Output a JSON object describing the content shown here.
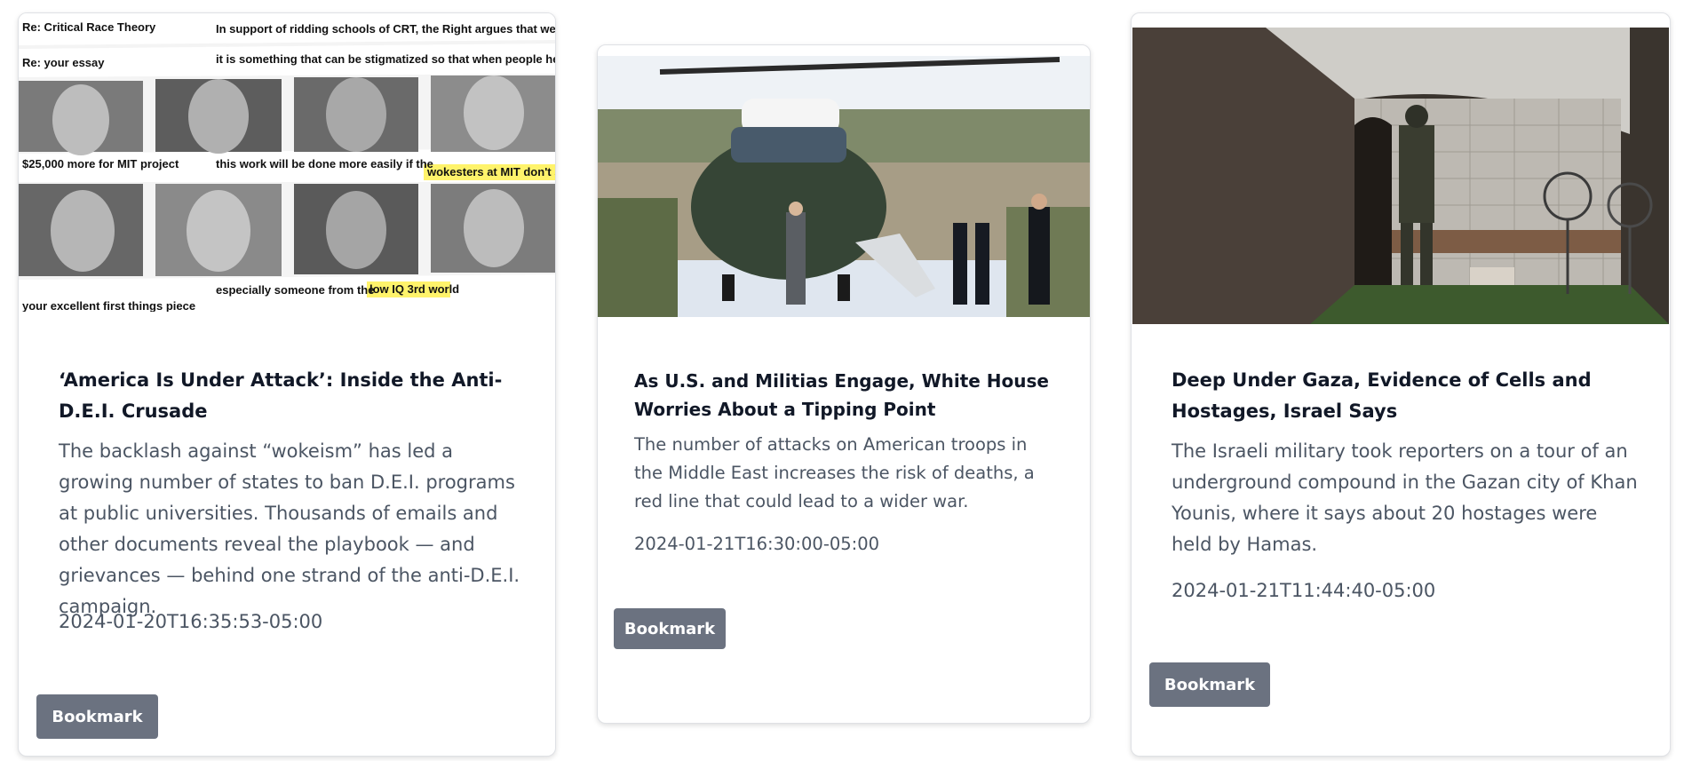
{
  "articles": [
    {
      "title": "‘America Is Under Attack’: Inside the Anti-D.E.I. Crusade",
      "description": "The backlash against “wokeism” has led a growing number of states to ban D.E.I. programs at public universities. Thousands of emails and other documents reveal the playbook — and grievances — behind one strand of the anti-D.E.I. campaign.",
      "date": "2024-01-20T16:35:53-05:00",
      "bookmark_label": "Bookmark",
      "image_text": {
        "line1": "Re: Critical Race Theory",
        "line2": "In support of ridding schools of CRT, the Right argues that we want",
        "line3": "Re: your essay",
        "line4": "it is something that can be stigmatized so that when people hear it",
        "line5": "$25,000 more for MIT project",
        "line6": "this work will be done more easily if the",
        "line6_highlight": "wokesters at MIT don't see",
        "line7": "especially someone from the",
        "line7_highlight": "low IQ 3rd world",
        "line8": "your excellent first things piece"
      }
    },
    {
      "title": "As U.S. and Militias Engage, White House Worries About a Tipping Point",
      "description": "The number of attacks on American troops in the Middle East increases the risk of deaths, a red line that could lead to a wider war.",
      "date": "2024-01-21T16:30:00-05:00",
      "bookmark_label": "Bookmark"
    },
    {
      "title": "Deep Under Gaza, Evidence of Cells and Hostages, Israel Says",
      "description": "The Israeli military took reporters on a tour of an underground compound in the Gazan city of Khan Younis, where it says about 20 hostages were held by Hamas.",
      "date": "2024-01-21T11:44:40-05:00",
      "bookmark_label": "Bookmark"
    }
  ]
}
